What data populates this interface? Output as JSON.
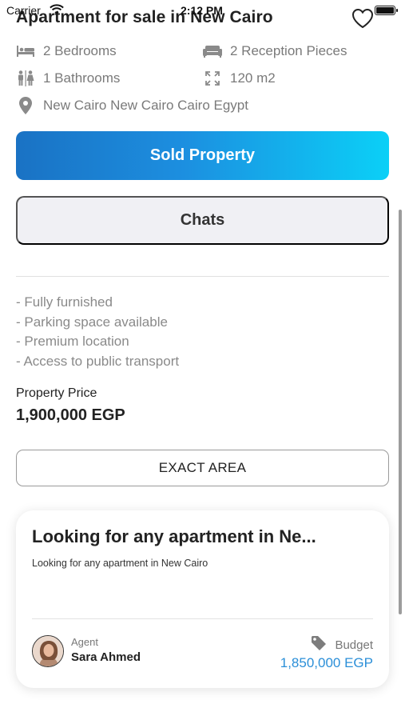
{
  "status_bar": {
    "carrier": "Carrier",
    "time": "2:12 PM"
  },
  "listing": {
    "title": "Apartment for sale in New Cairo",
    "features": {
      "bedrooms": "2 Bedrooms",
      "reception": "2 Reception Pieces",
      "bathrooms": "1 Bathrooms",
      "area": "120 m2",
      "location": "New Cairo New Cairo Cairo Egypt"
    },
    "description": [
      "- Fully furnished",
      "- Parking space available",
      "- Premium location",
      "- Access to public transport"
    ],
    "price_label": "Property Price",
    "price_value": "1,900,000 EGP"
  },
  "buttons": {
    "sold": "Sold Property",
    "chats": "Chats",
    "exact_area": "EXACT AREA"
  },
  "request_card": {
    "title": "Looking for any apartment in Ne...",
    "subtitle": "Looking for any apartment in New Cairo",
    "agent_label": "Agent",
    "agent_name": "Sara Ahmed",
    "budget_label": "Budget",
    "budget_value": "1,850,000 EGP"
  },
  "icons": {
    "heart": "heart-outline-icon",
    "bed": "bed-icon",
    "sofa": "sofa-icon",
    "bath": "restroom-icon",
    "area": "expand-icon",
    "location": "location-pin-icon",
    "tag": "tag-icon"
  },
  "colors": {
    "sold_gradient_start": "#1a72c4",
    "sold_gradient_end": "#0bd0f7",
    "budget_value": "#2b8fd8"
  }
}
